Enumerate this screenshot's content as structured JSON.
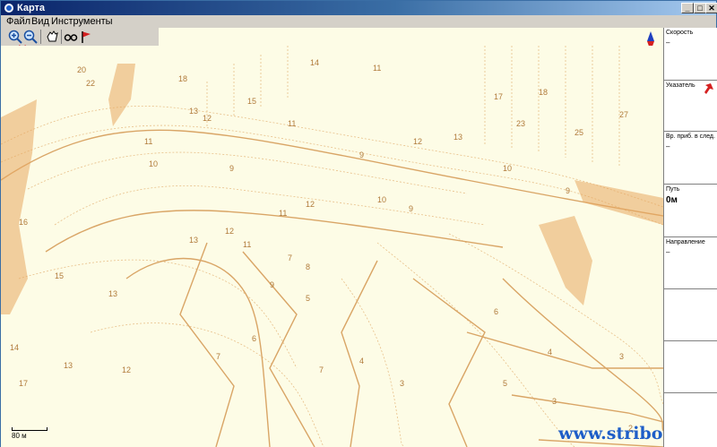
{
  "window": {
    "title": "Карта",
    "minimize": "_",
    "maximize": "□",
    "close": "✕"
  },
  "menu": {
    "file": "Файл",
    "view": "Вид",
    "tools": "Инструменты"
  },
  "panel": {
    "speed_label": "Скорость",
    "speed_value": "–",
    "pointer_label": "Указатель",
    "eta_label": "Вр. приб. в след.",
    "eta_value": "–",
    "path_label": "Путь",
    "path_value": "0м",
    "direction_label": "Направление",
    "direction_value": "–"
  },
  "map": {
    "scale_label": "80 м",
    "watermark": "www.striborg.ee",
    "contour_labels": [
      "14",
      "11",
      "18",
      "15",
      "13",
      "12",
      "10",
      "9",
      "8",
      "7",
      "6",
      "5",
      "4",
      "3",
      "2",
      "17",
      "16",
      "20",
      "22",
      "23",
      "25",
      "27"
    ]
  },
  "colors": {
    "contour": "#e8c08a",
    "contour_dark": "#c98a3e",
    "title_bar": "#0a246a",
    "watermark": "#1e5ec8"
  }
}
